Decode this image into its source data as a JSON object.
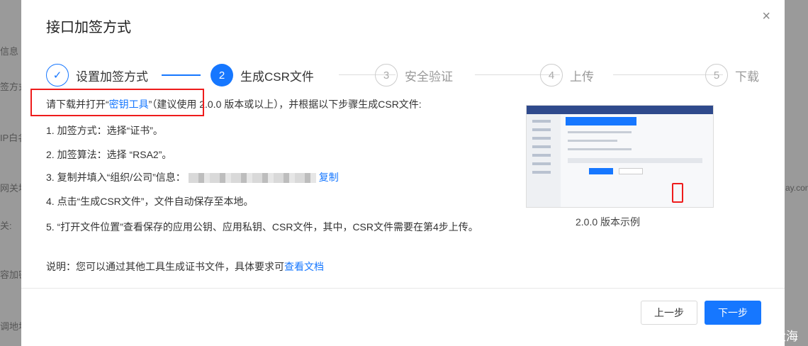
{
  "background": {
    "left_fragments": [
      "信息",
      "签方式",
      "IP白名",
      "网关地",
      "关:",
      "容加密",
      "调地址"
    ],
    "right_fragment": "ay.con"
  },
  "dialog": {
    "title": "接口加签方式",
    "close_glyph": "×",
    "steps": [
      {
        "index": "✓",
        "label": "设置加签方式",
        "state": "done"
      },
      {
        "index": "2",
        "label": "生成CSR文件",
        "state": "active"
      },
      {
        "index": "3",
        "label": "安全验证",
        "state": "wait"
      },
      {
        "index": "4",
        "label": "上传",
        "state": "wait"
      },
      {
        "index": "5",
        "label": "下载",
        "state": "wait"
      }
    ],
    "intro_prefix": "请下载并打开“",
    "intro_link": "密钥工具",
    "intro_suffix": "”（建议使用 2.0.0 版本或以上），并根据以下步骤生成CSR文件:",
    "instructions": {
      "line1": "1. 加签方式：选择“证书”。",
      "line2": "2. 加签算法：选择 “RSA2”。",
      "line3_prefix": "3. 复制并填入“组织/公司”信息：",
      "line3_link": "复制",
      "line4": "4. 点击“生成CSR文件”，文件自动保存至本地。",
      "line5": "5. “打开文件位置”查看保存的应用公钥、应用私钥、CSR文件，其中，CSR文件需要在第4步上传。"
    },
    "note_prefix": "说明：您可以通过其他工具生成证书文件，具体要求可",
    "note_link": "查看文档",
    "preview_caption": "2.0.0 版本示例",
    "prev_button": "上一步",
    "next_button": "下一步"
  },
  "watermark": "CSDN @亚历山大海",
  "colors": {
    "primary": "#1677ff",
    "highlight_red": "#ee1c1c"
  }
}
